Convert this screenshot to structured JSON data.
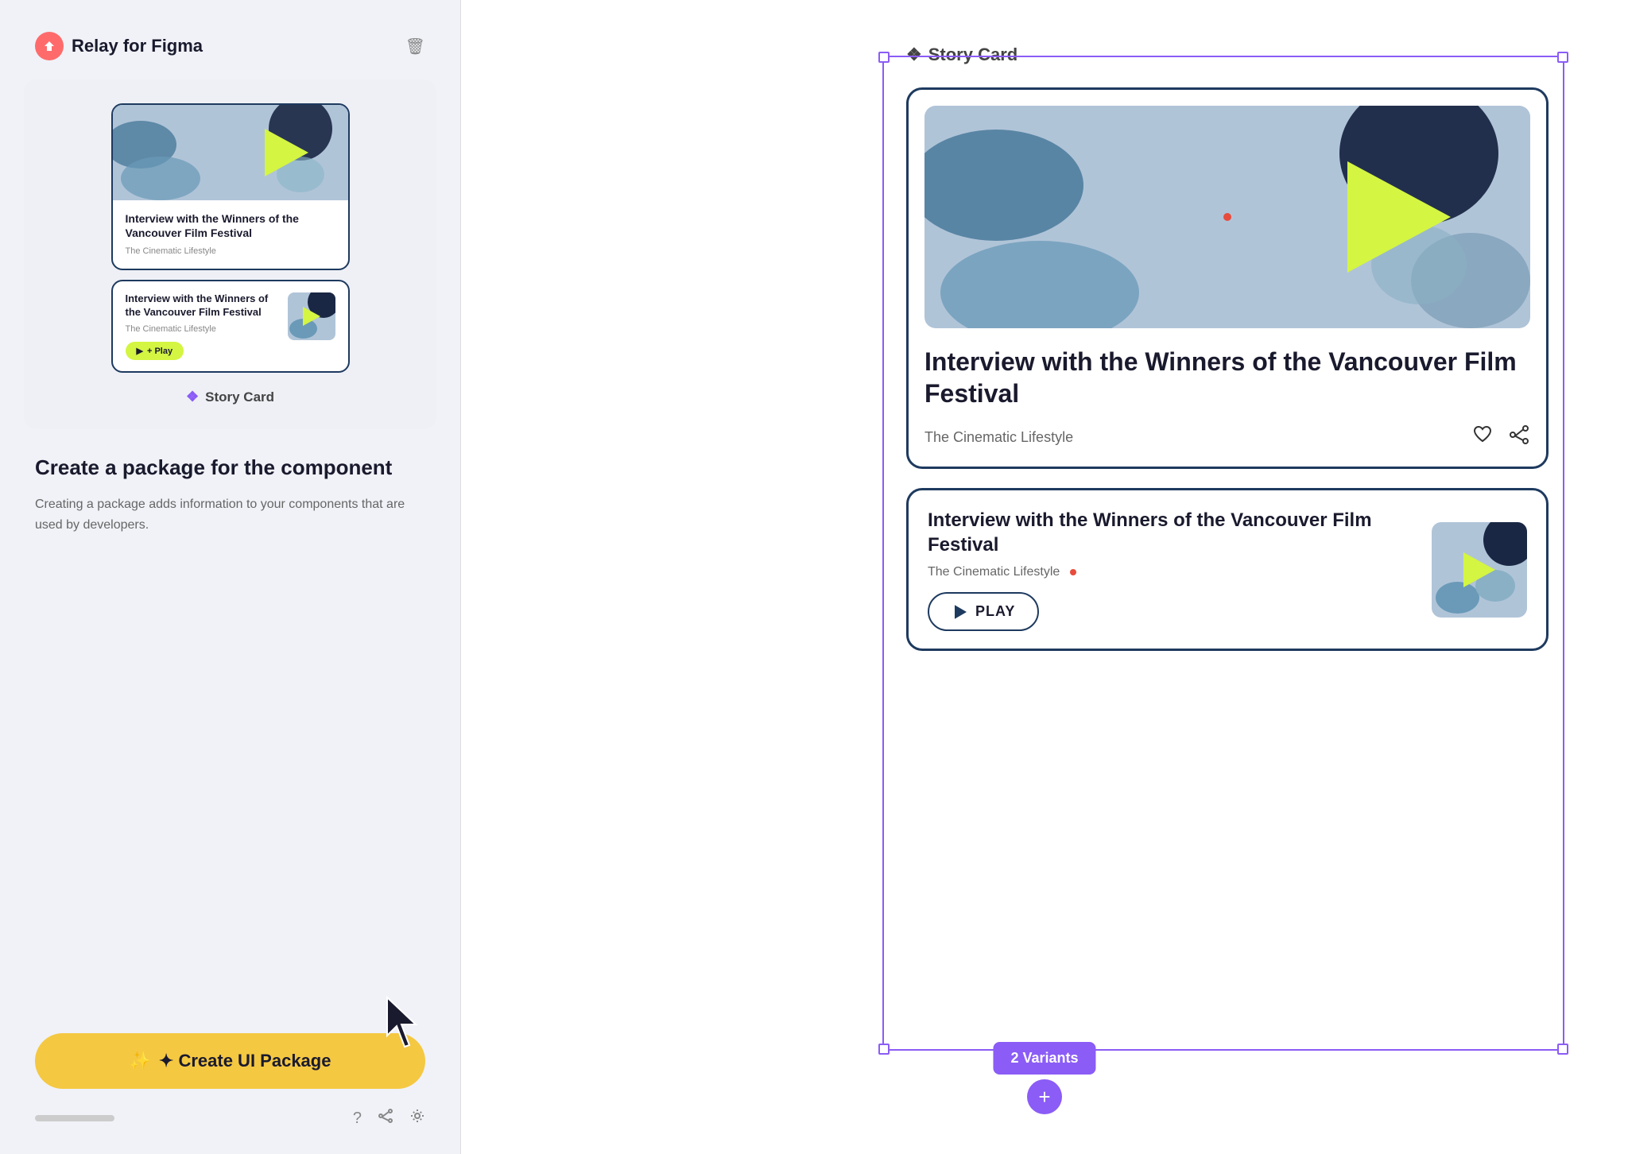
{
  "app": {
    "name": "Relay for Figma",
    "logo_color": "#ff6b6b"
  },
  "left_panel": {
    "component_name": "Story Card",
    "card1": {
      "title": "Interview with the Winners of the Vancouver Film Festival",
      "subtitle": "The Cinematic Lifestyle"
    },
    "card2": {
      "title": "Interview with the Winners of the Vancouver Film Festival",
      "subtitle": "The Cinematic Lifestyle",
      "play_label": "+ Play"
    },
    "info_title": "Create a package for the component",
    "info_desc": "Creating a package adds information to your components that are used by developers.",
    "create_btn_label": "✦ Create UI Package"
  },
  "right_panel": {
    "component_label": "Story Card",
    "card1": {
      "title": "Interview with the Winners of the Vancouver Film Festival",
      "subtitle": "The Cinematic Lifestyle"
    },
    "card2": {
      "title": "Interview with the Winners of the Vancouver Film Festival",
      "subtitle": "The Cinematic Lifestyle",
      "play_label": "PLAY"
    },
    "variants_count": "2 Variants"
  },
  "colors": {
    "accent": "#8b5cf6",
    "play_bg": "#d4f542",
    "brand_dark": "#1e3a5f",
    "card_bg_img": "#b0c4d8",
    "dark_blue": "#1a2744",
    "mid_blue": "#4a7a9b",
    "yellow_btn": "#f5c842"
  },
  "icons": {
    "trash": "🗑",
    "heart": "♡",
    "share": "⤴",
    "help": "?",
    "share2": "⤴",
    "settings": "⚙",
    "asterisk": "❖",
    "play": "▶",
    "plus": "+"
  }
}
